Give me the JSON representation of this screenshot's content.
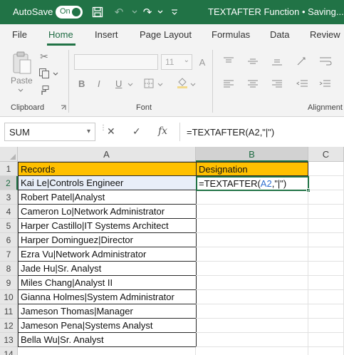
{
  "titlebar": {
    "autosave_label": "AutoSave",
    "toggle_label": "On",
    "document_title": "TEXTAFTER Function  •  Saving..."
  },
  "ribbon_tabs": [
    "File",
    "Home",
    "Insert",
    "Page Layout",
    "Formulas",
    "Data",
    "Review"
  ],
  "ribbon": {
    "paste_label": "Paste",
    "font_size": "11",
    "groups": {
      "clipboard": "Clipboard",
      "font": "Font",
      "alignment": "Alignment"
    },
    "format_buttons": [
      "B",
      "I",
      "U"
    ]
  },
  "formula_bar": {
    "name_box": "SUM",
    "fx_label": "fx",
    "formula": "=TEXTAFTER(A2,\"|\")"
  },
  "sheet": {
    "columns": [
      "A",
      "B",
      "C"
    ],
    "rows": [
      "1",
      "2",
      "3",
      "4",
      "5",
      "6",
      "7",
      "8",
      "9",
      "10",
      "11",
      "12",
      "13",
      "14"
    ],
    "headers": {
      "a1": "Records",
      "b1": "Designation"
    },
    "records": [
      "Kai Le|Controls Engineer",
      "Robert Patel|Analyst",
      "Cameron Lo|Network Administrator",
      "Harper Castillo|IT Systems Architect",
      "Harper Dominguez|Director",
      "Ezra Vu|Network Administrator",
      "Jade Hu|Sr. Analyst",
      "Miles Chang|Analyst II",
      "Gianna Holmes|System Administrator",
      "Jameson Thomas|Manager",
      "Jameson Pena|Systems Analyst",
      "Bella Wu|Sr. Analyst"
    ],
    "active_cell": {
      "prefix": "=TEXTAFTER(",
      "ref": "A2",
      "suffix": ",\"|\")"
    }
  }
}
